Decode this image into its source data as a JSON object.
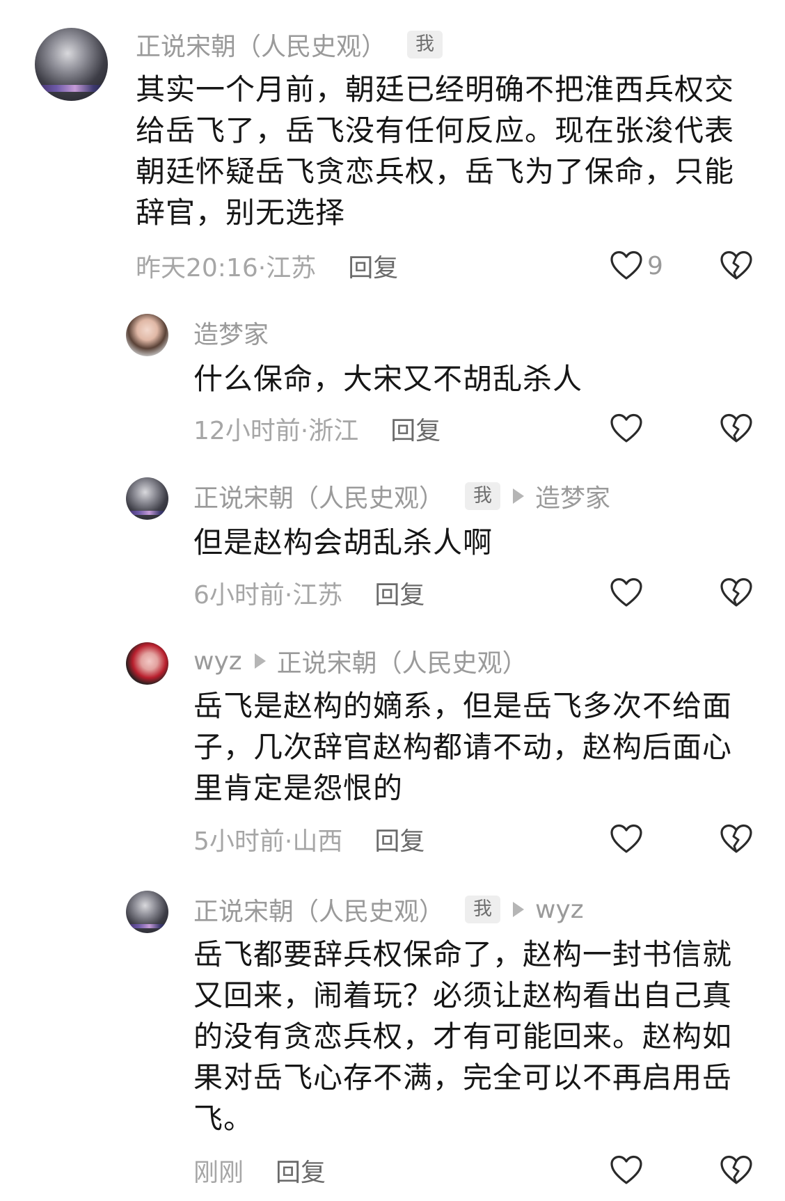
{
  "comments": [
    {
      "author": "正说宋朝（人民史观）",
      "me_badge": "我",
      "reply_to": "",
      "text": "其实一个月前，朝廷已经明确不把淮西兵权交给岳飞了，岳飞没有任何反应。现在张浚代表朝廷怀疑岳飞贪恋兵权，岳飞为了保命，只能辞官，别无选择",
      "time_location": "昨天20:16·江苏",
      "reply_label": "回复",
      "likes": "9"
    },
    {
      "author": "造梦家",
      "me_badge": "",
      "reply_to": "",
      "text": "什么保命，大宋又不胡乱杀人",
      "time_location": "12小时前·浙江",
      "reply_label": "回复",
      "likes": ""
    },
    {
      "author": "正说宋朝（人民史观）",
      "me_badge": "我",
      "reply_to": "造梦家",
      "text": "但是赵构会胡乱杀人啊",
      "time_location": "6小时前·江苏",
      "reply_label": "回复",
      "likes": ""
    },
    {
      "author": "wyz",
      "me_badge": "",
      "reply_to": "正说宋朝（人民史观）",
      "text": "岳飞是赵构的嫡系，但是岳飞多次不给面子，几次辞官赵构都请不动，赵构后面心里肯定是怨恨的",
      "time_location": "5小时前·山西",
      "reply_label": "回复",
      "likes": ""
    },
    {
      "author": "正说宋朝（人民史观）",
      "me_badge": "我",
      "reply_to": "wyz",
      "text": "岳飞都要辞兵权保命了，赵构一封书信就又回来，闹着玩？必须让赵构看出自己真的没有贪恋兵权，才有可能回来。赵构如果对岳飞心存不满，完全可以不再启用岳飞。",
      "time_location": "刚刚",
      "reply_label": "回复",
      "likes": ""
    }
  ],
  "icons": {
    "like": "heart-outline-icon",
    "dislike": "broken-heart-icon",
    "reply_arrow": "play-triangle-icon"
  },
  "colors": {
    "text": "#161616",
    "meta": "#9a9a9a",
    "badge_bg": "#eeeeee"
  }
}
